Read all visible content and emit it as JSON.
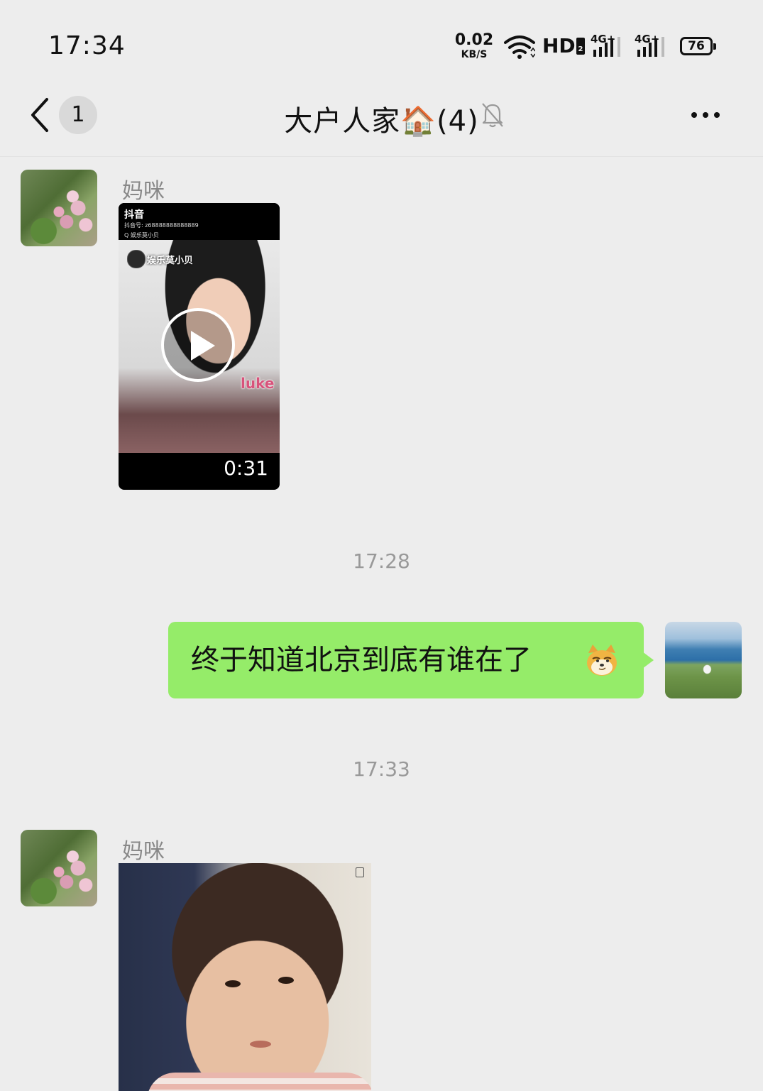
{
  "status_bar": {
    "time": "17:34",
    "net_speed_value": "0.02",
    "net_speed_unit": "KB/S",
    "hd_label": "HD",
    "sim1_label": "4G+",
    "sim2_label": "4G+",
    "battery_level": "76"
  },
  "header": {
    "unread_count": "1",
    "title": "大户人家🏠(4)"
  },
  "messages": [
    {
      "sender": "妈咪",
      "type": "video",
      "video": {
        "platform": "抖音",
        "account_line": "抖音号: z68888888888889",
        "search_line": "Q 娱乐莫小贝",
        "channel": "娱乐莫小贝",
        "overlay_text": "luke",
        "duration": "0:31"
      }
    },
    {
      "type": "timestamp",
      "text": "17:28"
    },
    {
      "type": "text",
      "direction": "outgoing",
      "text": "终于知道北京到底有谁在了"
    },
    {
      "type": "timestamp",
      "text": "17:33"
    },
    {
      "sender": "妈咪",
      "type": "sticker"
    }
  ],
  "colors": {
    "background": "#ededed",
    "outgoing_bubble": "#95ec69",
    "sender_name": "#888888",
    "timestamp": "#999999"
  }
}
